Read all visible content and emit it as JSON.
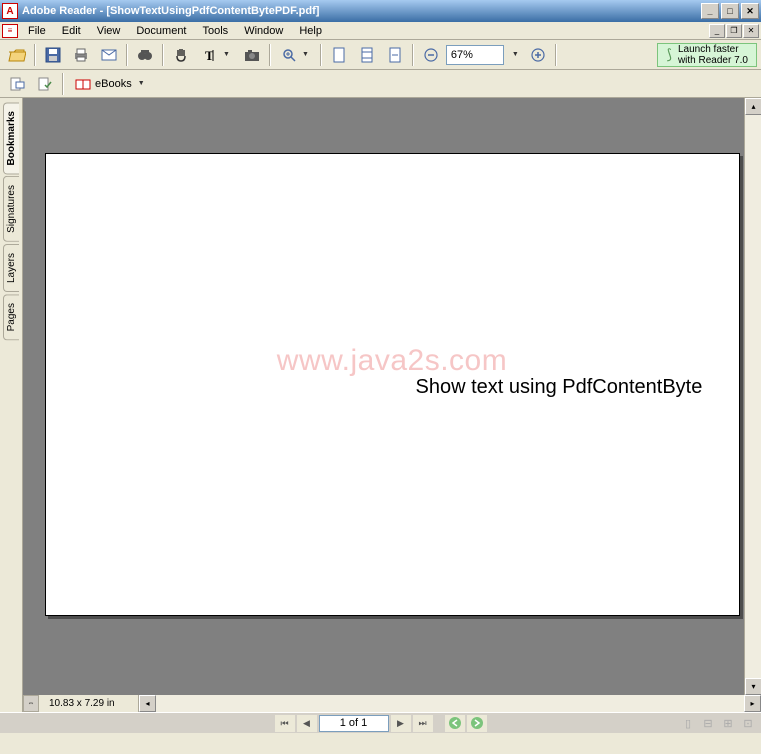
{
  "window": {
    "app_name": "Adobe Reader",
    "doc_name": "[ShowTextUsingPdfContentBytePDF.pdf]"
  },
  "menu": {
    "file": "File",
    "edit": "Edit",
    "view": "View",
    "document": "Document",
    "tools": "Tools",
    "window": "Window",
    "help": "Help"
  },
  "toolbar": {
    "zoom_value": "67%",
    "ebooks_label": "eBooks"
  },
  "banner": {
    "line1": "Launch faster",
    "line2": "with Reader 7.0"
  },
  "side_tabs": {
    "bookmarks": "Bookmarks",
    "signatures": "Signatures",
    "layers": "Layers",
    "pages": "Pages"
  },
  "document": {
    "watermark": "www.java2s.com",
    "body_text": "Show text using PdfContentByte",
    "dimensions": "10.83 x 7.29 in"
  },
  "status": {
    "page_indicator": "1 of 1"
  }
}
